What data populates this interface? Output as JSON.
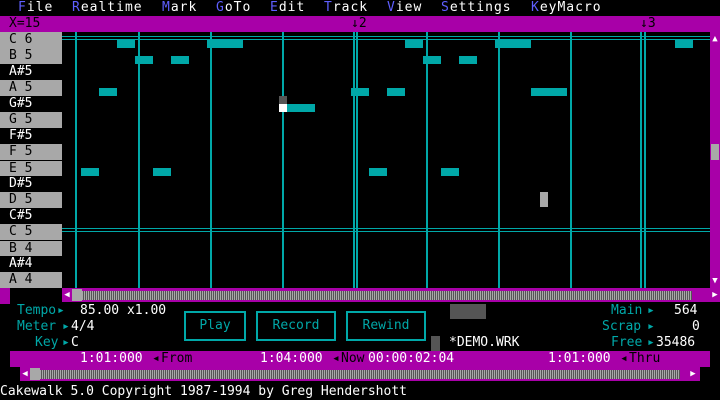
{
  "menu": [
    {
      "hk": "F",
      "rest": "ile"
    },
    {
      "hk": "R",
      "rest": "ealtime"
    },
    {
      "hk": "M",
      "rest": "ark"
    },
    {
      "hk": "G",
      "rest": "oTo"
    },
    {
      "hk": "E",
      "rest": "dit"
    },
    {
      "hk": "T",
      "rest": "rack"
    },
    {
      "hk": "V",
      "rest": "iew"
    },
    {
      "hk": "S",
      "rest": "ettings"
    },
    {
      "hk": "K",
      "rest": "eyMacro"
    }
  ],
  "ruler": {
    "zoom": "X=15",
    "marker2": "↓2",
    "marker3": "↓3"
  },
  "keys": [
    "C 6",
    "B 5",
    "A#5",
    "A 5",
    "G#5",
    "G 5",
    "F#5",
    "F 5",
    "E 5",
    "D#5",
    "D 5",
    "C#5",
    "C 5",
    "B 4",
    "A#4",
    "A 4"
  ],
  "panel": {
    "tempo_label": "Tempo",
    "tempo_value": "85.00 x1.00",
    "meter_label": "Meter",
    "meter_value": "4/4",
    "key_label": "Key",
    "key_value": "C",
    "play": "Play",
    "record": "Record",
    "rewind": "Rewind",
    "filename": "*DEMO.WRK",
    "main_label": "Main",
    "main_value": "564",
    "scrap_label": "Scrap",
    "scrap_value": "0",
    "free_label": "Free",
    "free_value": "35486"
  },
  "status": {
    "from_value": "1:01:000",
    "from_label": "From",
    "now_value": "1:04:000",
    "now_label": "Now",
    "time_value": "00:00:02:04",
    "thru_value": "1:01:000",
    "thru_label": "Thru"
  },
  "footer": "Cakewalk 5.0 Copyright 1987-1994 by Greg Hendershott",
  "colors": {
    "accent": "#a800a8",
    "cyan": "#00a8a8",
    "gray": "#a8a8a8",
    "menu_hotkey": "#5f5fff"
  }
}
